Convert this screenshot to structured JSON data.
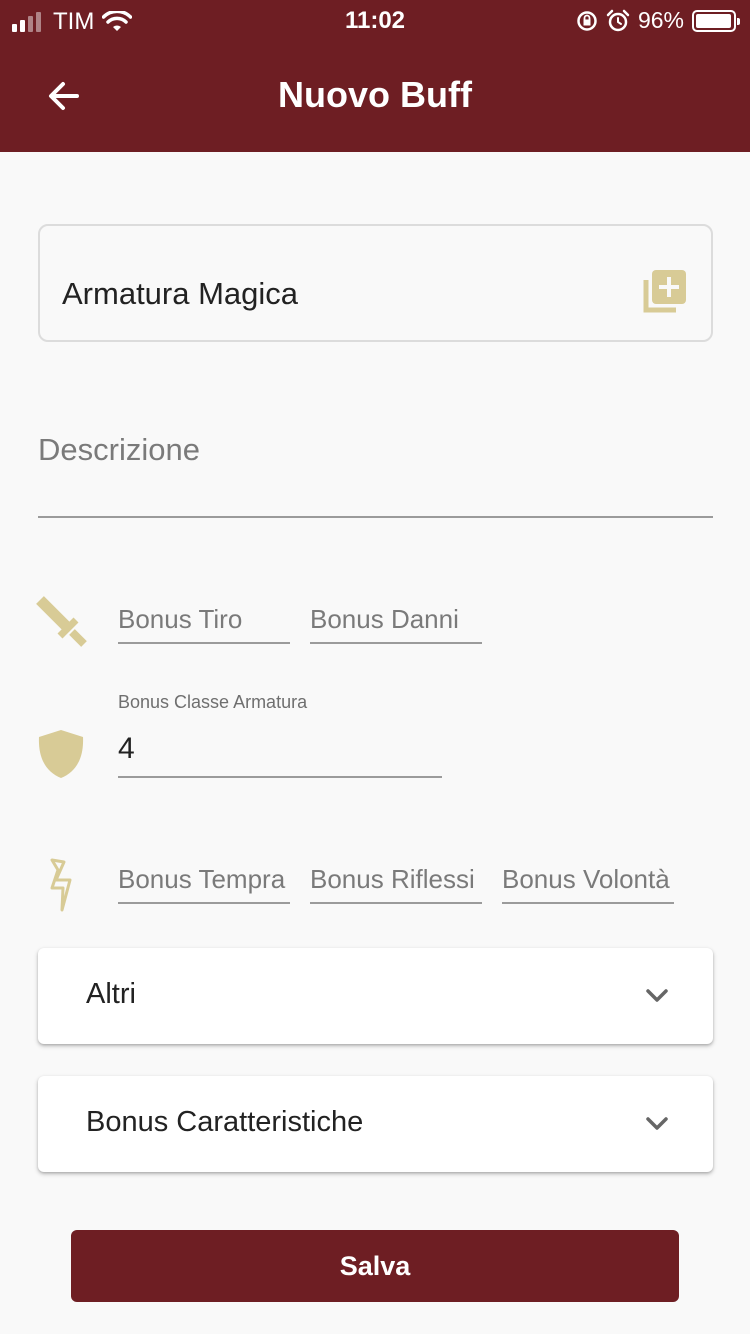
{
  "status_bar": {
    "carrier": "TIM",
    "time": "11:02",
    "battery": "96%",
    "battery_level": 0.96
  },
  "app_bar": {
    "title": "Nuovo Buff",
    "back_icon": "arrow-left-icon"
  },
  "form": {
    "name": {
      "value": "Armatura Magica",
      "icon": "library-add-icon"
    },
    "description": {
      "placeholder": "Descrizione"
    },
    "attack_row": {
      "icon": "sword-icon",
      "fields": [
        {
          "placeholder": "Bonus Tiro"
        },
        {
          "placeholder": "Bonus Danni"
        }
      ]
    },
    "armor_row": {
      "icon": "shield-icon",
      "label": "Bonus Classe Armatura",
      "value": "4"
    },
    "saves_row": {
      "icon": "lightning-icon",
      "fields": [
        {
          "placeholder": "Bonus Tempra"
        },
        {
          "placeholder": "Bonus Riflessi"
        },
        {
          "placeholder": "Bonus Volontà"
        }
      ]
    },
    "panels": [
      {
        "title": "Altri",
        "icon": "chevron-down-icon"
      },
      {
        "title": "Bonus Caratteristiche",
        "icon": "chevron-down-icon"
      }
    ],
    "save_label": "Salva"
  },
  "colors": {
    "primary": "#6e1e23",
    "accent_icon": "#d8cb96",
    "background": "#f9f9f9"
  }
}
